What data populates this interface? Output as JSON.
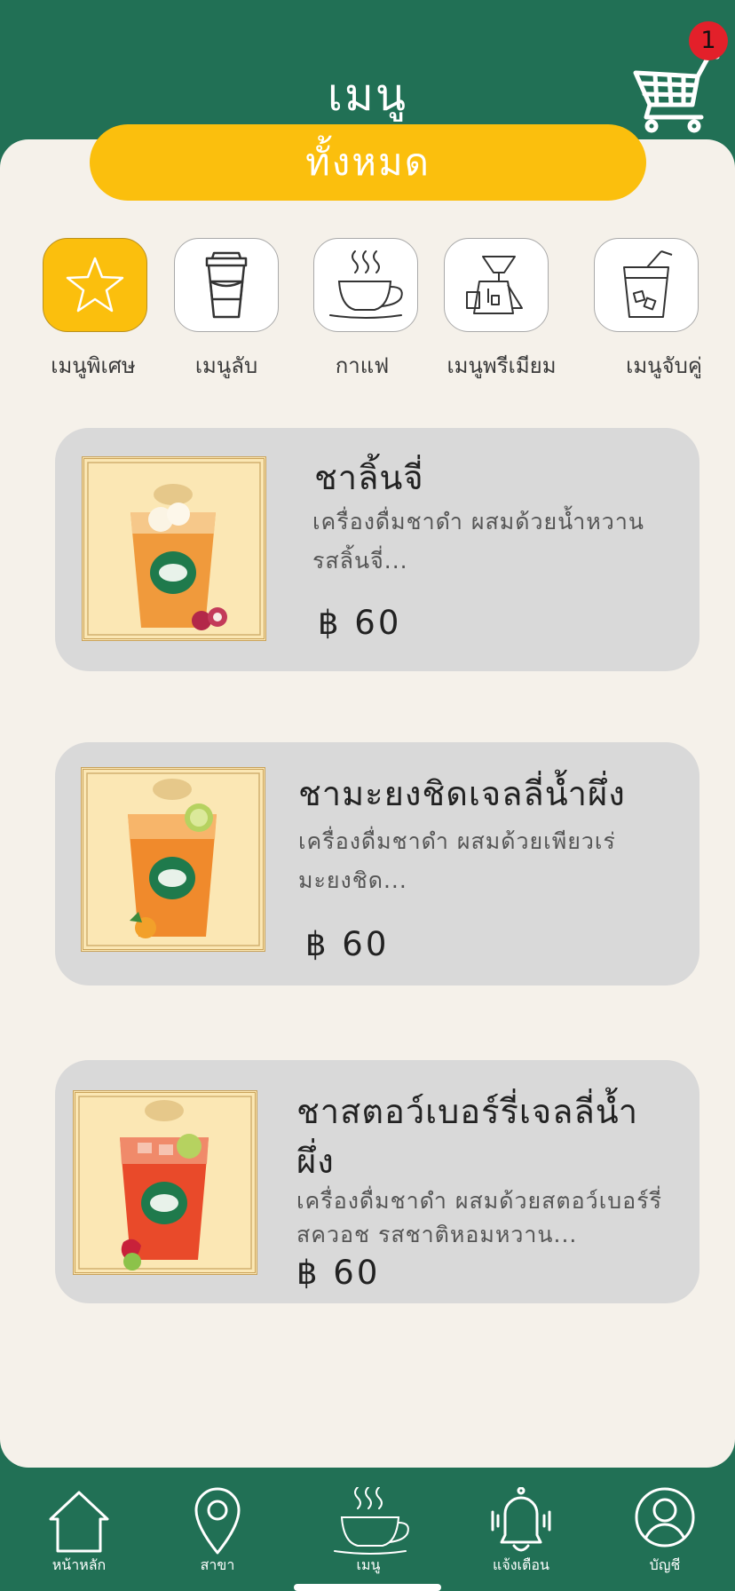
{
  "header": {
    "title": "เมนู",
    "cart_badge": "1",
    "cart_icon": "cart-icon"
  },
  "category_filter": {
    "label": "ทั้งหมด"
  },
  "categories": [
    {
      "label": "เมนูพิเศษ",
      "icon": "star-icon",
      "active": true
    },
    {
      "label": "เมนูลับ",
      "icon": "takeaway-cup-icon",
      "active": false
    },
    {
      "label": "กาแฟ",
      "icon": "coffee-cup-icon",
      "active": false
    },
    {
      "label": "เมนูพรีเมียม",
      "icon": "drip-coffee-icon",
      "active": false
    },
    {
      "label": "เมนูจับคู่",
      "icon": "iced-drink-icon",
      "active": false
    }
  ],
  "products": [
    {
      "name": "ชาลิ้นจี่",
      "description": "เครื่องดื่มชาดำ ผสมด้วยน้ำหวานรสลิ้นจี่...",
      "price": "฿ 60"
    },
    {
      "name": "ชามะยงชิดเจลลี่น้ำผึ่ง",
      "description": "เครื่องดื่มชาดำ ผสมด้วยเพียวเร่มะยงชิด...",
      "price": "฿ 60"
    },
    {
      "name": "ชาสตอว์เบอร์รี่เจลลี่น้ำผึ่ง",
      "description": "เครื่องดื่มชาดำ ผสมด้วยสตอว์เบอร์รี่สควอช รสชาติหอมหวาน...",
      "price": "฿ 60"
    }
  ],
  "bottom_nav": [
    {
      "label": "หน้าหลัก",
      "icon": "home-icon"
    },
    {
      "label": "สาขา",
      "icon": "location-pin-icon"
    },
    {
      "label": "เมนู",
      "icon": "coffee-cup-icon"
    },
    {
      "label": "แจ้งเตือน",
      "icon": "bell-icon"
    },
    {
      "label": "บัญชี",
      "icon": "account-icon"
    }
  ],
  "colors": {
    "brand_green": "#217055",
    "accent_yellow": "#fbbf0d",
    "background": "#f5f1ea",
    "card": "#d9d9d9",
    "badge_red": "#e3202a"
  }
}
